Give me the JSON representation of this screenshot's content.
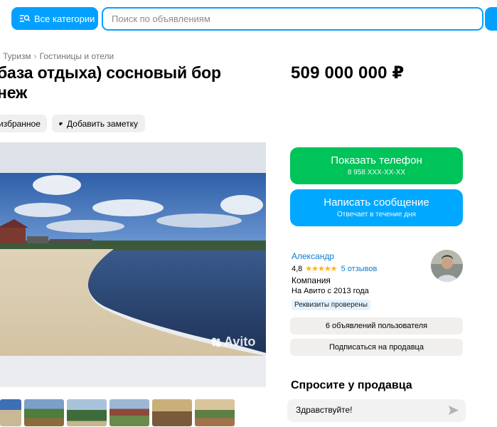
{
  "header": {
    "categories_label": "Все категории",
    "search_placeholder": "Поиск по объявлениям"
  },
  "breadcrumb": [
    "Туризм",
    "Гостиницы и отели"
  ],
  "breadcrumb_separator": "›",
  "listing": {
    "title_line1": "база отдыха) сосновый бор",
    "title_line2": "неж",
    "price": "509 000 000 ₽"
  },
  "actions": {
    "favorite_label": "избранное",
    "note_label": "Добавить заметку"
  },
  "photo": {
    "watermark": "Avito",
    "thumbnail_count": 6
  },
  "contact": {
    "phone_label": "Показать телефон",
    "phone_masked": "8 958 XXX-XX-XX",
    "message_label": "Написать сообщение",
    "message_sub": "Отвечает в течение дня"
  },
  "seller": {
    "name": "Александр",
    "rating": "4,8",
    "stars": 5,
    "reviews": "5 отзывов",
    "type": "Компания",
    "since": "На Авито с 2013 года",
    "verified": "Реквизиты проверены",
    "listings_button": "6 объявлений пользователя",
    "subscribe_button": "Подписаться на продавца"
  },
  "ask": {
    "title": "Спросите у продавца",
    "message": "Здравствуйте!"
  },
  "colors": {
    "accent_blue": "#04a0ff",
    "phone_green": "#00c35a",
    "message_blue": "#00a8ff",
    "link_blue": "#0a7ccc",
    "star_yellow": "#ffb021"
  }
}
